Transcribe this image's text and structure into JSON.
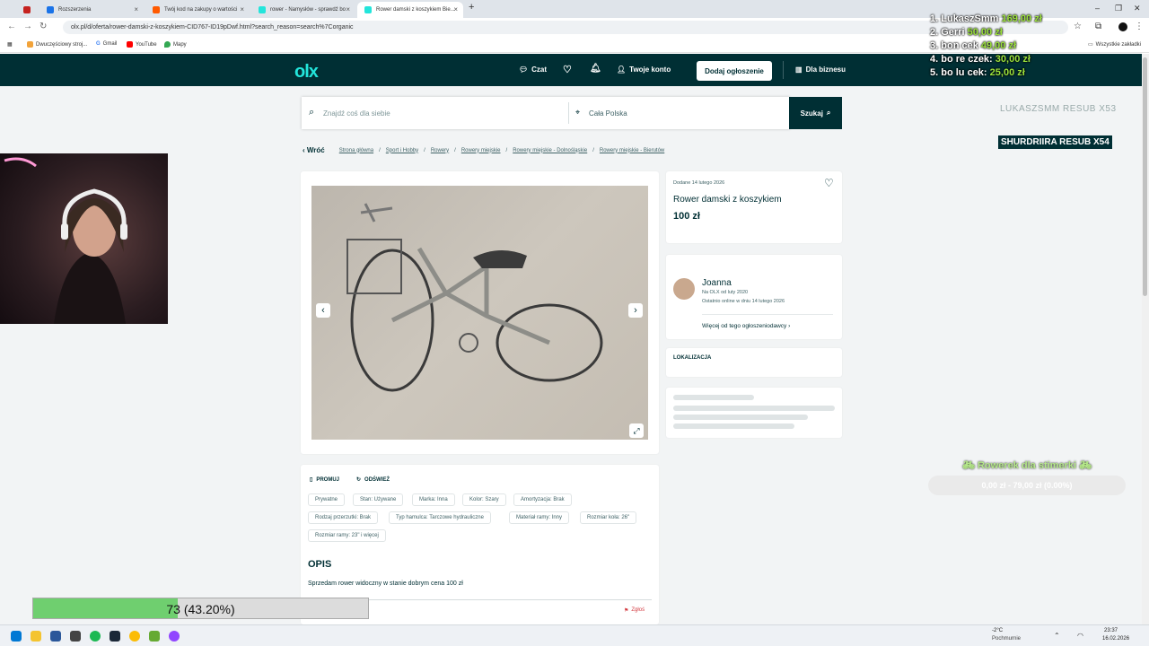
{
  "browser": {
    "tabs": [
      {
        "title": "",
        "icon": "gmail-icon",
        "color": "#c5221f"
      },
      {
        "title": "Rozszerzenia",
        "icon": "puzzle-icon",
        "color": "#1a73e8"
      },
      {
        "title": "Twój kod na zakupy o wartości",
        "icon": "allegro-icon",
        "color": "#ff5a00"
      },
      {
        "title": "rower - Namysłów - sprawdź bo",
        "icon": "olx-icon",
        "color": "#23e5db"
      },
      {
        "title": "Rower damski z koszykiem Bie...",
        "icon": "olx-icon",
        "color": "#23e5db"
      }
    ],
    "url": "olx.pl/d/oferta/rower-damski-z-koszykiem-CID767-ID19pDwf.html?search_reason=search%7Corganic",
    "bookmarks": [
      "Dwuczęściowy stroj...",
      "Gmail",
      "YouTube",
      "Mapy"
    ],
    "all_bookmarks": "Wszystkie zakładki"
  },
  "olx": {
    "logo": "olx",
    "nav": {
      "chat": "Czat",
      "account": "Twoje konto",
      "add": "Dodaj ogłoszenie",
      "business": "Dla biznesu"
    },
    "search": {
      "placeholder": "Znajdź coś dla siebie",
      "location": "Cała Polska",
      "button": "Szukaj"
    },
    "breadcrumb": {
      "back": "Wróć",
      "items": [
        "Strona główna",
        "Sport i Hobby",
        "Rowery",
        "Rowery miejskie",
        "Rowery miejskie - Dolnośląskie",
        "Rowery miejskie - Bierutów"
      ]
    },
    "ad": {
      "added": "Dodane 14 lutego 2026",
      "title": "Rower damski z koszykiem",
      "price": "100 zł",
      "promote": "PROMUJ",
      "refresh": "ODŚWIEŻ",
      "params": [
        "Prywatne",
        "Stan: Używane",
        "Marka: Inna",
        "Kolor: Szary",
        "Amortyzacja: Brak",
        "Rodzaj przerzutki: Brak",
        "Typ hamulca: Tarczowe hydrauliczne",
        "Materiał ramy: Inny",
        "Rozmiar koła: 26\"",
        "Rozmiar ramy: 23\" i więcej"
      ],
      "desc_title": "OPIS",
      "desc": "Sprzedam rower widoczny w stanie dobrym cena 100 zł",
      "report": "Zgłoś"
    },
    "seller": {
      "name": "Joanna",
      "since": "Na OLX od luty 2020",
      "online": "Ostatnio online w dniu 14 lutego 2026",
      "more": "Więcej od tego ogłoszeniodawcy"
    },
    "location_title": "LOKALIZACJA"
  },
  "overlay": {
    "leaders": [
      {
        "rank": "1.",
        "name": "LukaszSmm",
        "amount": "169,00 zł"
      },
      {
        "rank": "2.",
        "name": "Gerri",
        "amount": "50,00 zł"
      },
      {
        "rank": "3.",
        "name": "bon cek",
        "amount": "49,00 zł"
      },
      {
        "rank": "4.",
        "name": "bo re czek:",
        "amount": "30,00 zł"
      },
      {
        "rank": "5.",
        "name": "bo lu cek:",
        "amount": "25,00 zł"
      }
    ],
    "subs": [
      "LUKASZSMM   RESUB X53",
      "SHURDRIIRA   RESUB X54"
    ],
    "goal_title": "Rowerek dla stimerki",
    "goal_text": "0,00 zł - 79,00 zł (0.00%)",
    "goal_fraction": 0.0,
    "progress_text": "73 (43.20%)",
    "progress_fraction": 0.432
  },
  "taskbar": {
    "weather": "-2°C",
    "weather_desc": "Pochmurnie",
    "time": "23:37",
    "date": "16.02.2026"
  }
}
